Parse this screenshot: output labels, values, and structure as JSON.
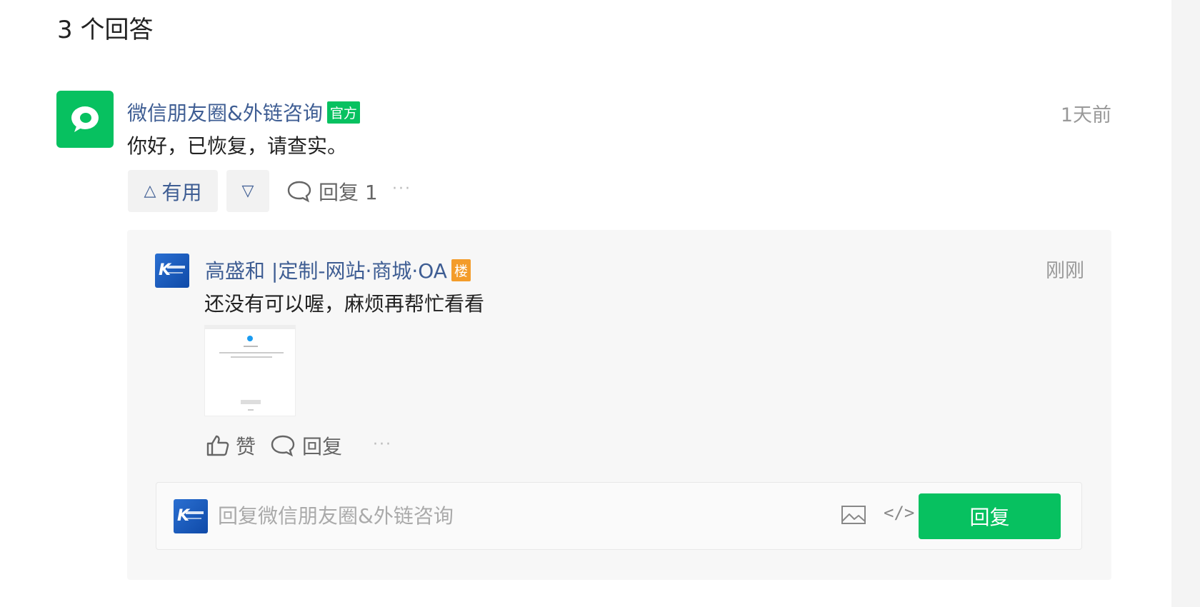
{
  "answers_header": {
    "title": "3 个回答"
  },
  "answer": {
    "author": "微信朋友圈&外链咨询",
    "badge": "官方",
    "time": "1天前",
    "content": "你好，已恢复，请查实。",
    "actions": {
      "upvote_icon": "△",
      "upvote_label": "有用",
      "downvote_icon": "▽",
      "reply_label": "回复 1",
      "more_label": "···"
    }
  },
  "comment": {
    "author": "高盛和 |定制-网站·商城·OA",
    "badge": "楼",
    "time": "刚刚",
    "content": "还没有可以喔，麻烦再帮忙看看",
    "actions": {
      "like_label": "赞",
      "reply_label": "回复",
      "more_label": "···"
    }
  },
  "reply_form": {
    "placeholder": "回复微信朋友圈&外链咨询",
    "code_icon": "</>",
    "submit_label": "回复"
  },
  "colors": {
    "accent_green": "#07c160",
    "link_blue": "#3e5d93",
    "floor_badge_orange": "#f39c2a"
  },
  "icons": {
    "official_avatar": "wechat-bubble-icon",
    "comment_avatar": "company-logo",
    "reply": "speech-bubble-icon",
    "like": "thumbs-up-icon",
    "image": "image-icon",
    "code": "code-icon"
  }
}
